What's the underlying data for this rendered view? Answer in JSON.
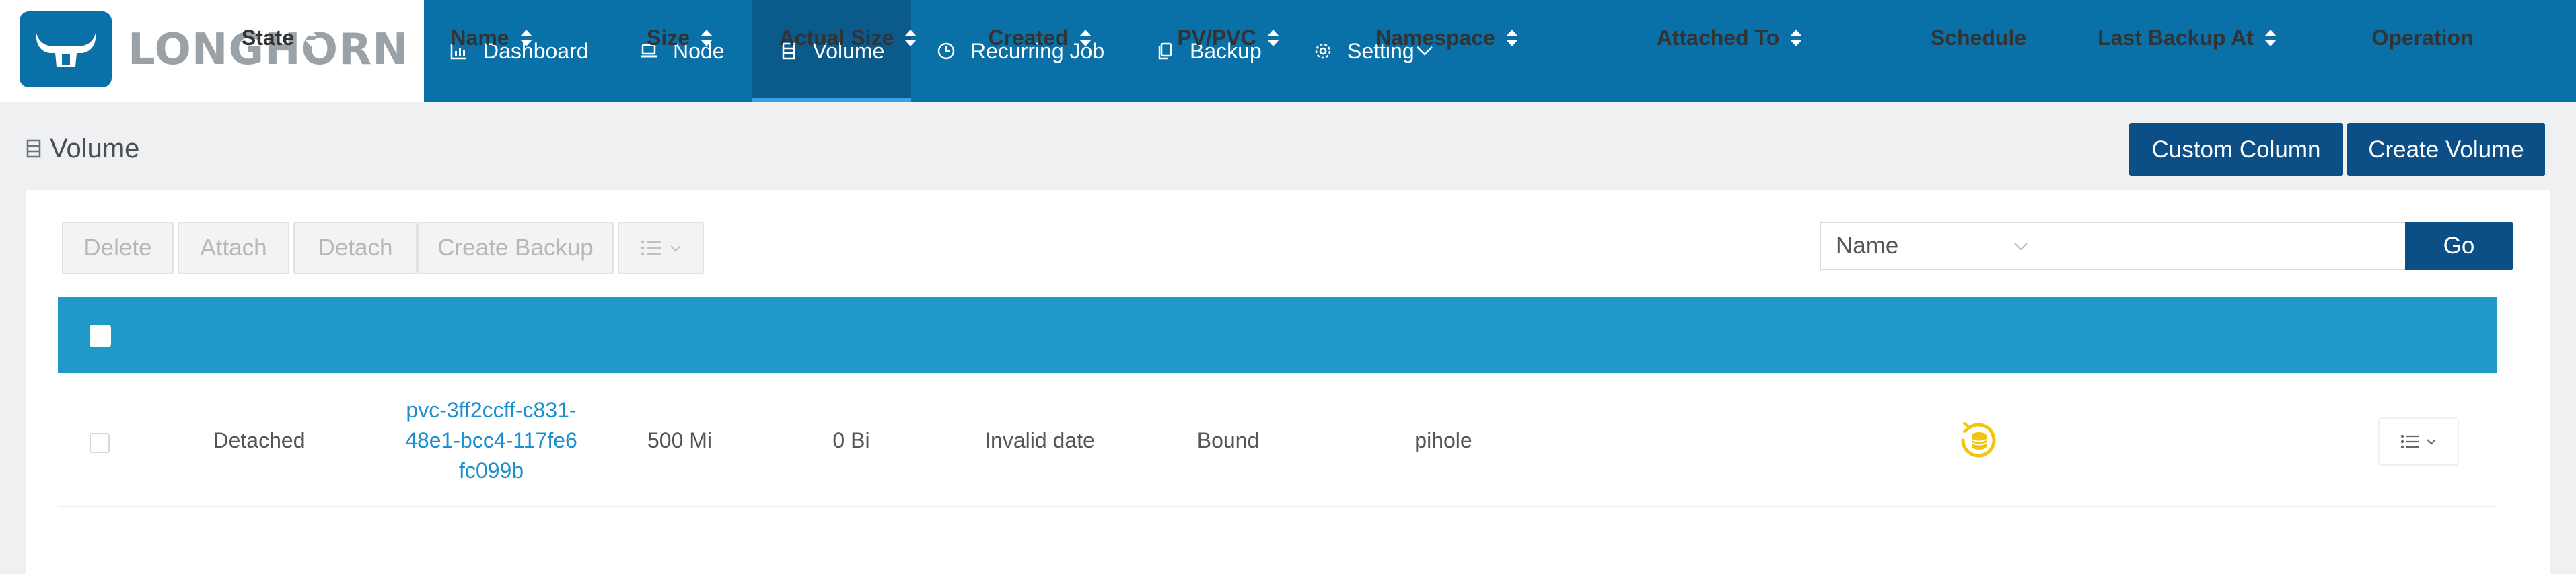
{
  "brand": {
    "name": "LONGHORN"
  },
  "nav": {
    "items": [
      {
        "label": "Dashboard",
        "icon": "bar-chart-icon"
      },
      {
        "label": "Node",
        "icon": "laptop-icon"
      },
      {
        "label": "Volume",
        "icon": "database-icon",
        "active": true
      },
      {
        "label": "Recurring Job",
        "icon": "clock-icon"
      },
      {
        "label": "Backup",
        "icon": "copy-icon"
      },
      {
        "label": "Setting",
        "icon": "gear-icon"
      }
    ]
  },
  "page": {
    "title": "Volume",
    "custom_column_label": "Custom Column",
    "create_volume_label": "Create Volume"
  },
  "toolbar": {
    "delete_label": "Delete",
    "attach_label": "Attach",
    "detach_label": "Detach",
    "create_backup_label": "Create Backup"
  },
  "search": {
    "field_value": "Name",
    "input_value": "",
    "go_label": "Go"
  },
  "table": {
    "columns": [
      "State",
      "Name",
      "Size",
      "Actual Size",
      "Created",
      "PV/PVC",
      "Namespace",
      "Attached To",
      "Schedule",
      "Last Backup At",
      "Operation"
    ],
    "rows": [
      {
        "state": "Detached",
        "name": "pvc-3ff2ccff-c831-48e1-bcc4-117fe6fc099b",
        "size": "500 Mi",
        "actual_size": "0 Bi",
        "created": "Invalid date",
        "pv_pvc": "Bound",
        "namespace": "pihole",
        "attached_to": "",
        "schedule_icon": "recurring-schedule-icon",
        "last_backup_at": ""
      }
    ]
  },
  "colors": {
    "navbar": "#0a70a8",
    "nav_active": "#0b5a8c",
    "table_header": "#1e99c8",
    "primary_button": "#0b4f86",
    "link": "#1a8fd0",
    "schedule_icon": "#f1c40f"
  }
}
